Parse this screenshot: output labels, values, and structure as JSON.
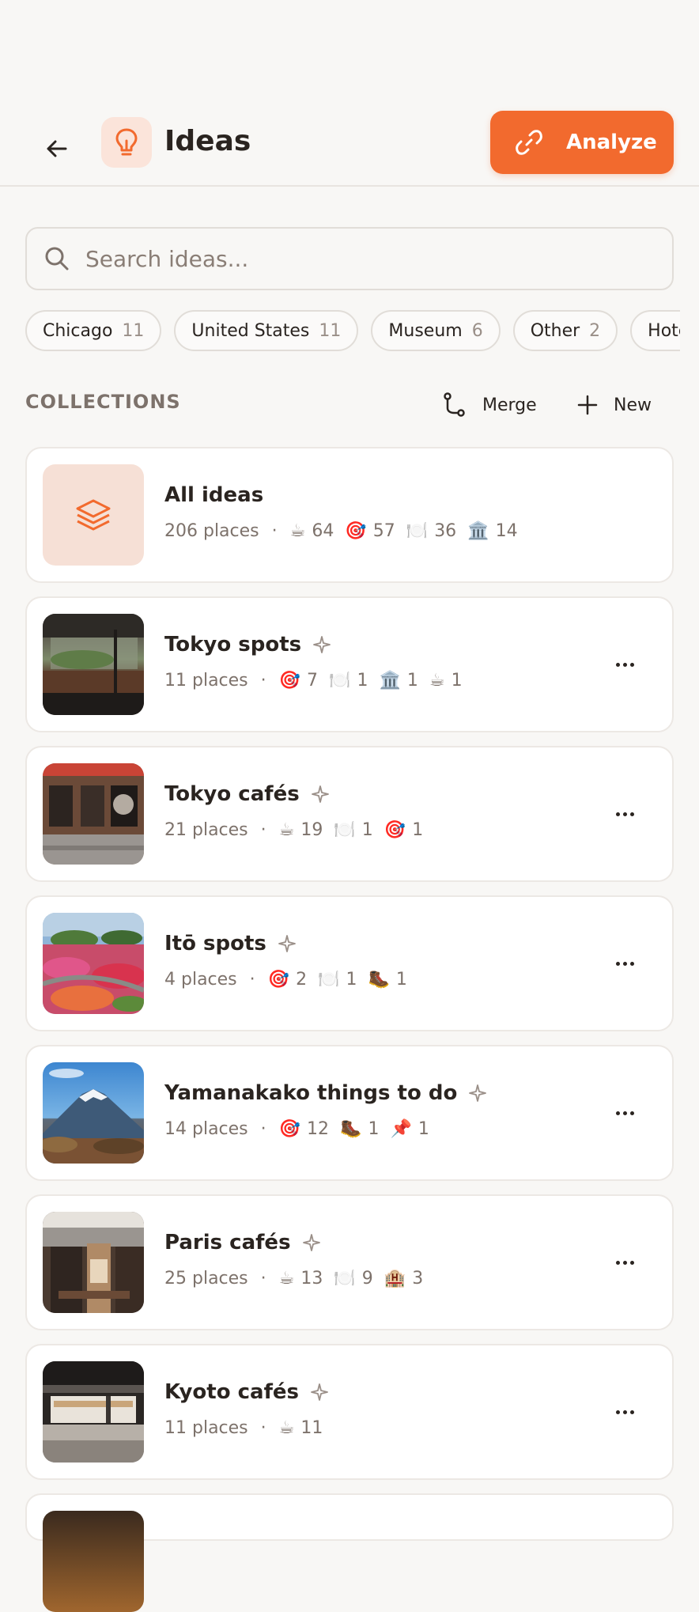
{
  "header": {
    "title": "Ideas",
    "analyze_label": "Analyze"
  },
  "search": {
    "placeholder": "Search ideas..."
  },
  "chips": [
    {
      "label": "Chicago",
      "count": "11"
    },
    {
      "label": "United States",
      "count": "11"
    },
    {
      "label": "Museum",
      "count": "6"
    },
    {
      "label": "Other",
      "count": "2"
    },
    {
      "label": "Hote",
      "count": ""
    }
  ],
  "collections": {
    "label": "COLLECTIONS",
    "merge_label": "Merge",
    "new_label": "New"
  },
  "all_ideas": {
    "title": "All ideas",
    "places": "206 places",
    "stats": [
      {
        "icon": "☕",
        "count": "64"
      },
      {
        "icon": "🎯",
        "count": "57"
      },
      {
        "icon": "🍽️",
        "count": "36"
      },
      {
        "icon": "🏛️",
        "count": "14"
      }
    ]
  },
  "cards": [
    {
      "title": "Tokyo spots",
      "places": "11 places",
      "stats": [
        {
          "icon": "🎯",
          "count": "7"
        },
        {
          "icon": "🍽️",
          "count": "1"
        },
        {
          "icon": "🏛️",
          "count": "1"
        },
        {
          "icon": "☕",
          "count": "1"
        }
      ]
    },
    {
      "title": "Tokyo cafés",
      "places": "21 places",
      "stats": [
        {
          "icon": "☕",
          "count": "19"
        },
        {
          "icon": "🍽️",
          "count": "1"
        },
        {
          "icon": "🎯",
          "count": "1"
        }
      ]
    },
    {
      "title": "Itō spots",
      "places": "4 places",
      "stats": [
        {
          "icon": "🎯",
          "count": "2"
        },
        {
          "icon": "🍽️",
          "count": "1"
        },
        {
          "icon": "🥾",
          "count": "1"
        }
      ]
    },
    {
      "title": "Yamanakako things to do",
      "places": "14 places",
      "stats": [
        {
          "icon": "🎯",
          "count": "12"
        },
        {
          "icon": "🥾",
          "count": "1"
        },
        {
          "icon": "📌",
          "count": "1"
        }
      ]
    },
    {
      "title": "Paris cafés",
      "places": "25 places",
      "stats": [
        {
          "icon": "☕",
          "count": "13"
        },
        {
          "icon": "🍽️",
          "count": "9"
        },
        {
          "icon": "🏨",
          "count": "3"
        }
      ]
    },
    {
      "title": "Kyoto cafés",
      "places": "11 places",
      "stats": [
        {
          "icon": "☕",
          "count": "11"
        }
      ]
    }
  ],
  "colors": {
    "accent": "#f26a2e",
    "accent_soft": "#fbe4da",
    "background": "#f8f7f5",
    "text": "#2a2420",
    "muted": "#7d726b"
  }
}
